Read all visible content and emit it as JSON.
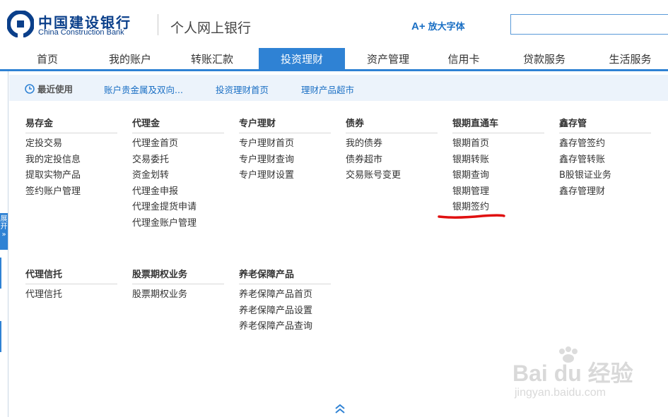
{
  "header": {
    "bank_name_cn": "中国建设银行",
    "bank_name_en": "China Construction Bank",
    "portal_title": "个人网上银行",
    "enlarge_font": "放大字体",
    "enlarge_icon": "A+",
    "search_value": "",
    "brand_color": "#0a3f8a"
  },
  "nav": {
    "items": [
      "首页",
      "我的账户",
      "转账汇款",
      "投资理财",
      "资产管理",
      "信用卡",
      "贷款服务",
      "生活服务"
    ],
    "active": "投资理财",
    "accent_color": "#2f82d4"
  },
  "subbar": {
    "recent_label": "最近使用",
    "links": [
      "账户贵金属及双向...",
      "投资理财首页",
      "理财产品超市"
    ]
  },
  "side": {
    "expand_label": "展开"
  },
  "menu": {
    "columns": [
      {
        "title": "易存金",
        "items": [
          "定投交易",
          "我的定投信息",
          "提取实物产品",
          "签约账户管理"
        ]
      },
      {
        "title": "代理金",
        "items": [
          "代理金首页",
          "交易委托",
          "资金划转",
          "代理金申报",
          "代理金提货申请",
          "代理金账户管理"
        ]
      },
      {
        "title": "专户理财",
        "items": [
          "专户理财首页",
          "专户理财查询",
          "专户理财设置"
        ]
      },
      {
        "title": "债券",
        "items": [
          "我的债券",
          "债券超市",
          "交易账号变更"
        ]
      },
      {
        "title": "银期直通车",
        "items": [
          "银期首页",
          "银期转账",
          "银期查询",
          "银期管理",
          "银期签约"
        ]
      },
      {
        "title": "鑫存管",
        "items": [
          "鑫存管签约",
          "鑫存管转账",
          "B股银证业务",
          "鑫存管理财"
        ]
      },
      {
        "title": "代理信托",
        "items": [
          "代理信托"
        ]
      },
      {
        "title": "股票期权业务",
        "items": [
          "股票期权业务"
        ]
      },
      {
        "title": "养老保障产品",
        "items": [
          "养老保障产品首页",
          "养老保障产品设置",
          "养老保障产品查询"
        ]
      }
    ],
    "highlighted_item": "银期签约",
    "highlight_color": "#e01010"
  },
  "watermark": {
    "main": "Bai du 经验",
    "sub": "jingyan.baidu.com"
  }
}
